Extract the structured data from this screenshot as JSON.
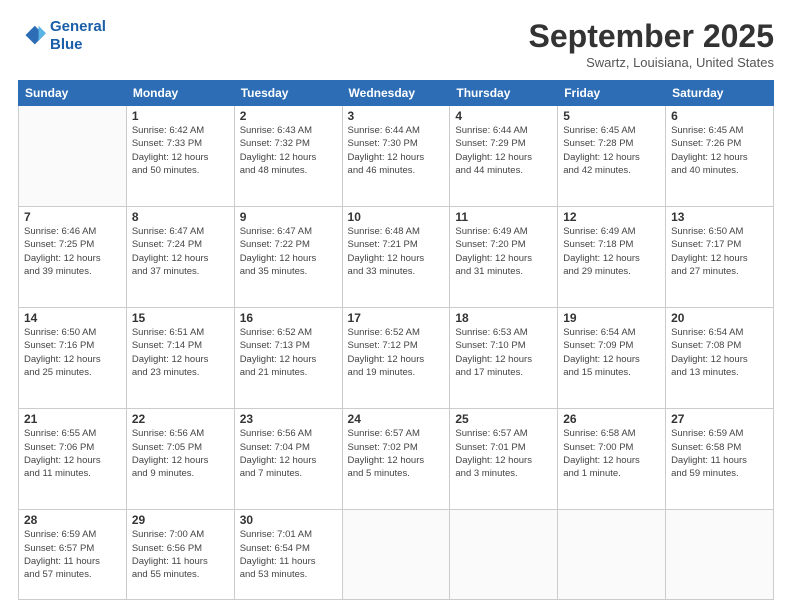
{
  "header": {
    "logo_line1": "General",
    "logo_line2": "Blue",
    "month": "September 2025",
    "location": "Swartz, Louisiana, United States"
  },
  "days_of_week": [
    "Sunday",
    "Monday",
    "Tuesday",
    "Wednesday",
    "Thursday",
    "Friday",
    "Saturday"
  ],
  "weeks": [
    [
      {
        "day": "",
        "info": ""
      },
      {
        "day": "1",
        "info": "Sunrise: 6:42 AM\nSunset: 7:33 PM\nDaylight: 12 hours\nand 50 minutes."
      },
      {
        "day": "2",
        "info": "Sunrise: 6:43 AM\nSunset: 7:32 PM\nDaylight: 12 hours\nand 48 minutes."
      },
      {
        "day": "3",
        "info": "Sunrise: 6:44 AM\nSunset: 7:30 PM\nDaylight: 12 hours\nand 46 minutes."
      },
      {
        "day": "4",
        "info": "Sunrise: 6:44 AM\nSunset: 7:29 PM\nDaylight: 12 hours\nand 44 minutes."
      },
      {
        "day": "5",
        "info": "Sunrise: 6:45 AM\nSunset: 7:28 PM\nDaylight: 12 hours\nand 42 minutes."
      },
      {
        "day": "6",
        "info": "Sunrise: 6:45 AM\nSunset: 7:26 PM\nDaylight: 12 hours\nand 40 minutes."
      }
    ],
    [
      {
        "day": "7",
        "info": "Sunrise: 6:46 AM\nSunset: 7:25 PM\nDaylight: 12 hours\nand 39 minutes."
      },
      {
        "day": "8",
        "info": "Sunrise: 6:47 AM\nSunset: 7:24 PM\nDaylight: 12 hours\nand 37 minutes."
      },
      {
        "day": "9",
        "info": "Sunrise: 6:47 AM\nSunset: 7:22 PM\nDaylight: 12 hours\nand 35 minutes."
      },
      {
        "day": "10",
        "info": "Sunrise: 6:48 AM\nSunset: 7:21 PM\nDaylight: 12 hours\nand 33 minutes."
      },
      {
        "day": "11",
        "info": "Sunrise: 6:49 AM\nSunset: 7:20 PM\nDaylight: 12 hours\nand 31 minutes."
      },
      {
        "day": "12",
        "info": "Sunrise: 6:49 AM\nSunset: 7:18 PM\nDaylight: 12 hours\nand 29 minutes."
      },
      {
        "day": "13",
        "info": "Sunrise: 6:50 AM\nSunset: 7:17 PM\nDaylight: 12 hours\nand 27 minutes."
      }
    ],
    [
      {
        "day": "14",
        "info": "Sunrise: 6:50 AM\nSunset: 7:16 PM\nDaylight: 12 hours\nand 25 minutes."
      },
      {
        "day": "15",
        "info": "Sunrise: 6:51 AM\nSunset: 7:14 PM\nDaylight: 12 hours\nand 23 minutes."
      },
      {
        "day": "16",
        "info": "Sunrise: 6:52 AM\nSunset: 7:13 PM\nDaylight: 12 hours\nand 21 minutes."
      },
      {
        "day": "17",
        "info": "Sunrise: 6:52 AM\nSunset: 7:12 PM\nDaylight: 12 hours\nand 19 minutes."
      },
      {
        "day": "18",
        "info": "Sunrise: 6:53 AM\nSunset: 7:10 PM\nDaylight: 12 hours\nand 17 minutes."
      },
      {
        "day": "19",
        "info": "Sunrise: 6:54 AM\nSunset: 7:09 PM\nDaylight: 12 hours\nand 15 minutes."
      },
      {
        "day": "20",
        "info": "Sunrise: 6:54 AM\nSunset: 7:08 PM\nDaylight: 12 hours\nand 13 minutes."
      }
    ],
    [
      {
        "day": "21",
        "info": "Sunrise: 6:55 AM\nSunset: 7:06 PM\nDaylight: 12 hours\nand 11 minutes."
      },
      {
        "day": "22",
        "info": "Sunrise: 6:56 AM\nSunset: 7:05 PM\nDaylight: 12 hours\nand 9 minutes."
      },
      {
        "day": "23",
        "info": "Sunrise: 6:56 AM\nSunset: 7:04 PM\nDaylight: 12 hours\nand 7 minutes."
      },
      {
        "day": "24",
        "info": "Sunrise: 6:57 AM\nSunset: 7:02 PM\nDaylight: 12 hours\nand 5 minutes."
      },
      {
        "day": "25",
        "info": "Sunrise: 6:57 AM\nSunset: 7:01 PM\nDaylight: 12 hours\nand 3 minutes."
      },
      {
        "day": "26",
        "info": "Sunrise: 6:58 AM\nSunset: 7:00 PM\nDaylight: 12 hours\nand 1 minute."
      },
      {
        "day": "27",
        "info": "Sunrise: 6:59 AM\nSunset: 6:58 PM\nDaylight: 11 hours\nand 59 minutes."
      }
    ],
    [
      {
        "day": "28",
        "info": "Sunrise: 6:59 AM\nSunset: 6:57 PM\nDaylight: 11 hours\nand 57 minutes."
      },
      {
        "day": "29",
        "info": "Sunrise: 7:00 AM\nSunset: 6:56 PM\nDaylight: 11 hours\nand 55 minutes."
      },
      {
        "day": "30",
        "info": "Sunrise: 7:01 AM\nSunset: 6:54 PM\nDaylight: 11 hours\nand 53 minutes."
      },
      {
        "day": "",
        "info": ""
      },
      {
        "day": "",
        "info": ""
      },
      {
        "day": "",
        "info": ""
      },
      {
        "day": "",
        "info": ""
      }
    ]
  ]
}
